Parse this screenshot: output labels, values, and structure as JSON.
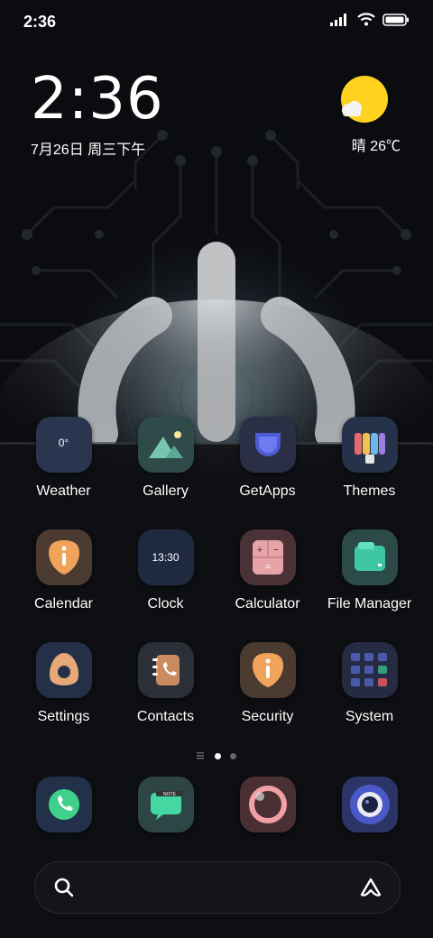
{
  "status_bar": {
    "time": "2:36"
  },
  "clock_widget": {
    "time": "2:36",
    "date": "7月26日 周三下午"
  },
  "weather_widget": {
    "text": "晴 26℃"
  },
  "apps": [
    {
      "label": "Weather",
      "icon_text": "0°"
    },
    {
      "label": "Gallery"
    },
    {
      "label": "GetApps"
    },
    {
      "label": "Themes"
    },
    {
      "label": "Calendar"
    },
    {
      "label": "Clock",
      "icon_text": "13:30"
    },
    {
      "label": "Calculator"
    },
    {
      "label": "File Manager"
    },
    {
      "label": "Settings"
    },
    {
      "label": "Contacts"
    },
    {
      "label": "Security"
    },
    {
      "label": "System"
    }
  ],
  "dock": [
    "phone-icon",
    "messaging-icon",
    "browser-icon",
    "camera-icon"
  ],
  "colors": {
    "accent_orange": "#f0a35a",
    "accent_green": "#46d8a2",
    "sun_yellow": "#ffd21f"
  }
}
